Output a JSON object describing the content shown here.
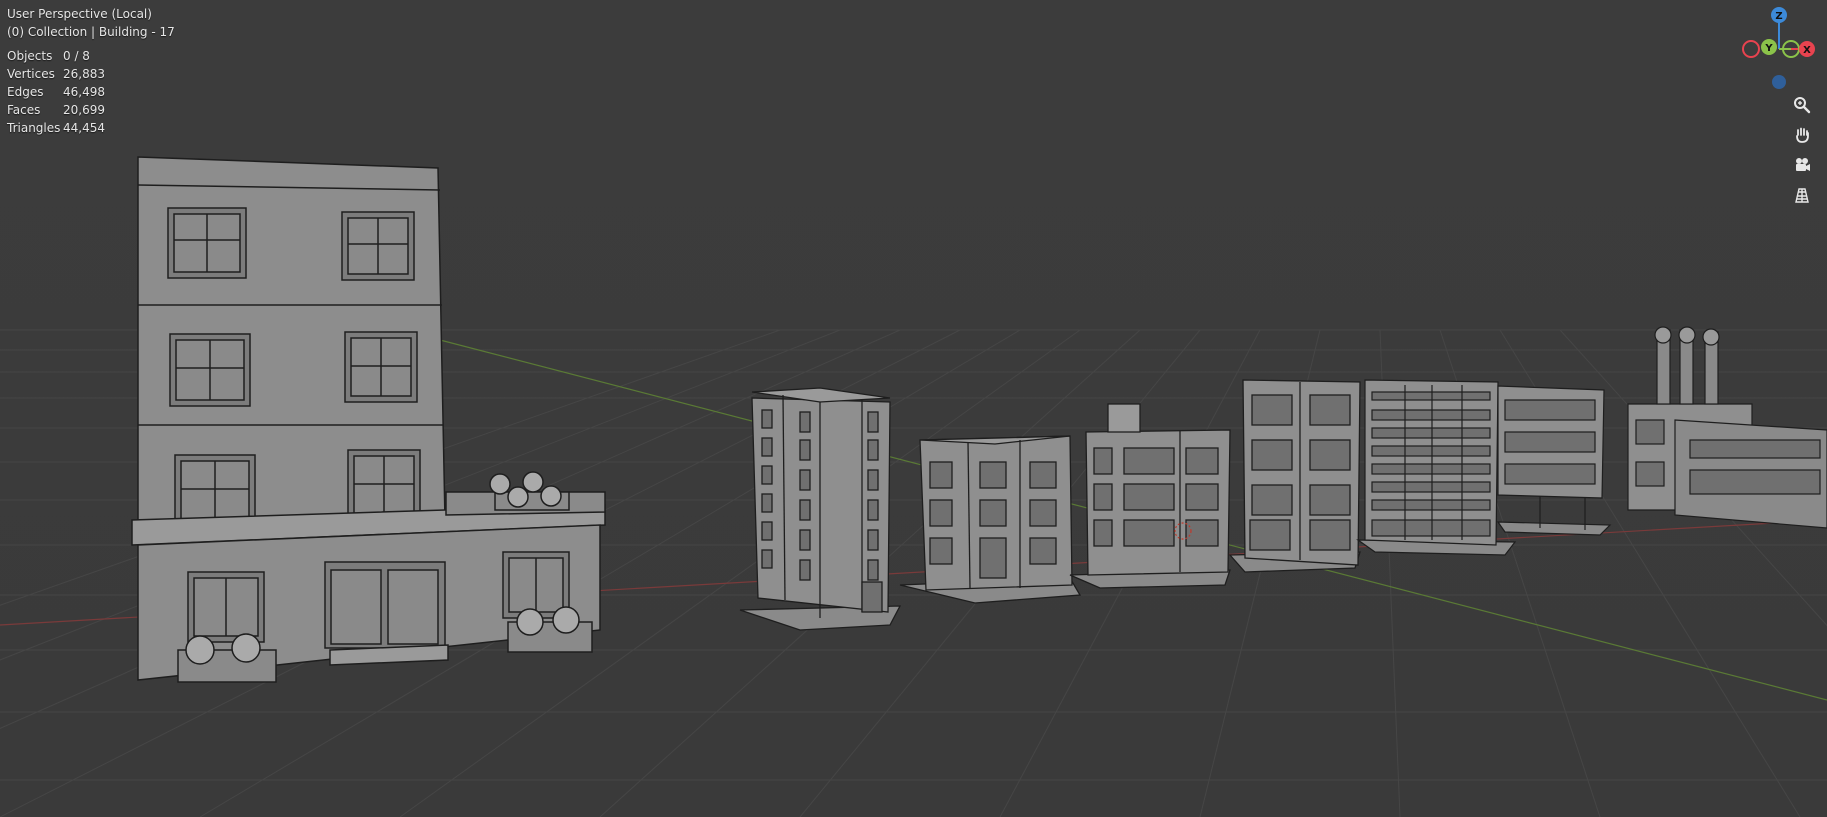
{
  "viewport": {
    "title": "User Perspective (Local)",
    "collection": "(0) Collection | Building - 17"
  },
  "stats": [
    {
      "label": "Objects",
      "value": "0 / 8"
    },
    {
      "label": "Vertices",
      "value": "26,883"
    },
    {
      "label": "Edges",
      "value": "46,498"
    },
    {
      "label": "Faces",
      "value": "20,699"
    },
    {
      "label": "Triangles",
      "value": "44,454"
    }
  ],
  "gizmo": {
    "z_label": "Z",
    "y_label": "Y",
    "x_label": "X",
    "colors": {
      "x": "#e8434f",
      "y": "#8bc34a",
      "z": "#3c8ad9"
    }
  },
  "tools": [
    {
      "name": "zoom",
      "icon": "zoom-icon"
    },
    {
      "name": "pan",
      "icon": "hand-icon"
    },
    {
      "name": "camera",
      "icon": "camera-icon"
    },
    {
      "name": "ortho",
      "icon": "grid-icon"
    }
  ]
}
